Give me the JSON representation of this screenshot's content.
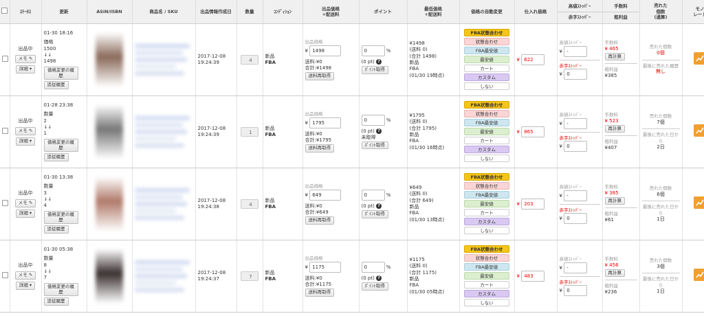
{
  "headers": {
    "status": "ｽﾃｰﾀｽ",
    "updated": "更新",
    "asin": "ASIN/ISBN",
    "name": "商品名 / SKU",
    "created": "出品情報作成日",
    "qty": "数量",
    "cond": "ｺﾝﾃﾞｨｼｮﾝ",
    "price": "出品価格\n+配送料",
    "point": "ポイント",
    "lowest": "最低価格\n+配送料",
    "auto": "価格の自動変更",
    "cost": "仕入れ価格",
    "stopper_high": "高値ｽﾄｯﾊﾟｰ",
    "stopper_low": "赤字ｽﾄｯﾊﾟｰ",
    "fee": "手数料",
    "profit": "粗利益",
    "sold": "売れた\n個数\n(通算)",
    "mono": "モノ\nレート"
  },
  "labels": {
    "status": "出品中",
    "memo": "メモ",
    "detail": "詳細",
    "price_hist": "価格変更の履歴",
    "track_hist": "追従履歴",
    "price_label": "出品価格",
    "yen": "¥",
    "reacquire": "送料再取得",
    "pt_reacquire": "ﾎﾟｲﾝﾄ取得",
    "high_stop": "高値ｽﾄｯﾊﾟｰ",
    "low_stop": "赤字ｽﾄｯﾊﾟｰ",
    "fee": "手数料",
    "recalc": "再計算",
    "profit": "粗利益",
    "sold_count": "売れた個数",
    "last_sold": "最後に売れた履歴",
    "last_sold_days": "最後に売れた日から",
    "auto_buttons": [
      "FBA状態合わせ",
      "状態合わせ",
      "FBA最安値",
      "最安値",
      "カート",
      "カスタム",
      "しない"
    ]
  },
  "rows": [
    {
      "upd_time": "01-30 18:16",
      "upd_l1": "価格",
      "upd_v1": "1500",
      "upd_arrow": "↓↓",
      "upd_v2": "1498",
      "created": "2017-12-08 19:24:39",
      "qty": "4",
      "cond": "新品",
      "fba": "FBA",
      "price": "1498",
      "ship": "送料:¥0",
      "total": "合計:¥1498",
      "point": "0",
      "pct": "%",
      "pt": "(0 pt)",
      "pt_note": "",
      "lowest": [
        "¥1498",
        "(送料 0)",
        "(合計 1498)",
        "新品",
        "FBA",
        "(01/30 19時点)"
      ],
      "cost": "622",
      "high": "-",
      "low": "0",
      "fee": "¥ 465",
      "profit": "¥385",
      "sold": "0個",
      "sold_red": true,
      "last_label": "最後に売れた履歴",
      "last_val": "無し",
      "last_red": true
    },
    {
      "upd_time": "01-28 23:38",
      "upd_l1": "数量",
      "upd_v1": "2",
      "upd_arrow": "↓↓",
      "upd_v2": "1",
      "created": "2017-12-08 19:24:39",
      "qty": "1",
      "cond": "新品",
      "fba": "FBA",
      "price": "1795",
      "ship": "送料:¥0",
      "total": "合計:¥1795",
      "point": "0",
      "pct": "%",
      "pt": "(0 pt)",
      "pt_note": "未取得",
      "lowest": [
        "¥1795",
        "(送料 0)",
        "(合計 1795)",
        "新品",
        "FBA",
        "(01/30 16時点)"
      ],
      "cost": "865",
      "high": "-",
      "low": "0",
      "fee": "¥ 523",
      "profit": "¥407",
      "sold": "7個",
      "sold_red": false,
      "last_label": "最後に売れた日から",
      "last_val": "2日",
      "last_red": false
    },
    {
      "upd_time": "01-30 13:38",
      "upd_l1": "数量",
      "upd_v1": "3",
      "upd_arrow": "↓↓",
      "upd_v2": "4",
      "created": "2017-12-08 19:24:38",
      "qty": "4",
      "cond": "新品",
      "fba": "FBA",
      "price": "649",
      "ship": "送料:¥0",
      "total": "合計:¥649",
      "point": "0",
      "pct": "%",
      "pt": "(0 pt)",
      "pt_note": "",
      "lowest": [
        "¥649",
        "(送料 0)",
        "(合計 649)",
        "新品",
        "FBA",
        "(01/30 13時点)"
      ],
      "cost": "203",
      "high": "-",
      "low": "0",
      "fee": "¥ 385",
      "profit": "¥61",
      "sold": "6個",
      "sold_red": false,
      "last_label": "最後に売れた日から",
      "last_val": "1日",
      "last_red": false
    },
    {
      "upd_time": "01-30 05:38",
      "upd_l1": "数量",
      "upd_v1": "8",
      "upd_arrow": "↓↓",
      "upd_v2": "7",
      "created": "2017-12-08 19:24:37",
      "qty": "7",
      "cond": "新品",
      "fba": "FBA",
      "price": "1175",
      "ship": "送料:¥0",
      "total": "合計:¥1175",
      "point": "0",
      "pct": "%",
      "pt": "(0 pt)",
      "pt_note": "",
      "lowest": [
        "¥1175",
        "(送料 0)",
        "(合計 1175)",
        "新品",
        "FBA",
        "(01/30 05時点)"
      ],
      "cost": "483",
      "high": "-",
      "low": "0",
      "fee": "¥ 456",
      "profit": "¥236",
      "sold": "3個",
      "sold_red": false,
      "last_label": "最後に売れた日から",
      "last_val": "1日",
      "last_red": false
    }
  ]
}
